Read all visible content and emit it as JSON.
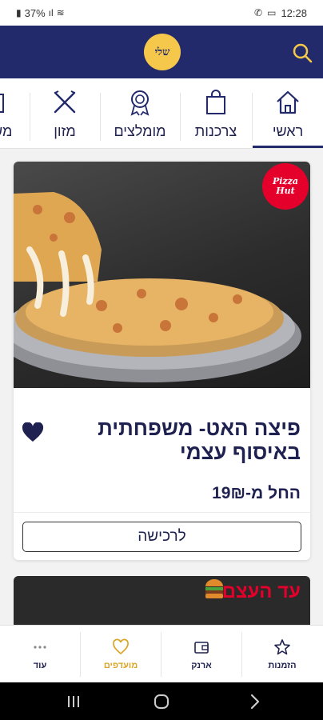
{
  "status_bar": {
    "battery": "37%",
    "time": "12:28"
  },
  "header": {
    "logo_text": "שלי"
  },
  "tabs": [
    {
      "label": "ראשי",
      "icon": "home-icon"
    },
    {
      "label": "צרכנות",
      "icon": "shopping-bag-icon"
    },
    {
      "label": "מומלצים",
      "icon": "award-icon"
    },
    {
      "label": "מזון",
      "icon": "fork-knife-icon"
    },
    {
      "label": "מש",
      "icon": "more-category-icon"
    }
  ],
  "card": {
    "brand": {
      "line1": "Pizza",
      "line2": "Hut"
    },
    "title": "פיצה האט- משפחתית באיסוף עצמי",
    "price": "החל מ-19₪",
    "cta": "לרכישה",
    "favorited": true
  },
  "card2": {
    "headline": "עד העצם"
  },
  "bottom_nav": [
    {
      "label": "הזמנות",
      "icon": "star-icon"
    },
    {
      "label": "ארנק",
      "icon": "wallet-icon"
    },
    {
      "label": "מועדפים",
      "icon": "heart-icon",
      "active": true
    },
    {
      "label": "עוד",
      "icon": "more-dots-icon"
    }
  ],
  "colors": {
    "primary": "#222a6b",
    "accent": "#f5c84b",
    "brand_red": "#e4002b",
    "active_nav": "#d9a526"
  }
}
